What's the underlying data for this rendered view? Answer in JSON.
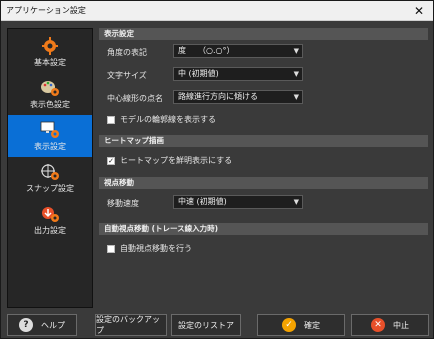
{
  "window": {
    "title": "アプリケーション設定",
    "close_glyph": "✕"
  },
  "sidebar": {
    "items": [
      {
        "label": "基本設定",
        "icon": "gear-icon",
        "active": false
      },
      {
        "label": "表示色設定",
        "icon": "palette-gear-icon",
        "active": false
      },
      {
        "label": "表示設定",
        "icon": "monitor-gear-icon",
        "active": true
      },
      {
        "label": "スナップ設定",
        "icon": "snap-gear-icon",
        "active": false
      },
      {
        "label": "出力設定",
        "icon": "output-gear-icon",
        "active": false
      }
    ]
  },
  "sections": {
    "display": {
      "header": "表示設定",
      "angle_label": "角度の表記",
      "angle_value": "度　　（○.○°）",
      "text_size_label": "文字サイズ",
      "text_size_value": "中 (初期値)",
      "center_label": "中心線形の点名",
      "center_value": "路線進行方向に傾ける",
      "model_outline_label": "モデルの輪郭線を表示する",
      "model_outline_checked": false
    },
    "heatmap": {
      "header": "ヒートマップ描画",
      "vivid_label": "ヒートマップを鮮明表示にする",
      "vivid_checked": true
    },
    "viewpoint": {
      "header": "視点移動",
      "speed_label": "移動速度",
      "speed_value": "中速 (初期値)"
    },
    "auto_viewpoint": {
      "header": "自動視点移動 (トレース線入力時)",
      "auto_label": "自動視点移動を行う",
      "auto_checked": false
    }
  },
  "footer": {
    "help": "ヘルプ",
    "backup": "設定のバックアップ",
    "restore": "設定のリストア",
    "ok": "確定",
    "cancel": "中止"
  },
  "colors": {
    "accent": "#0a6fd6",
    "ok_icon": "#f5a300",
    "cancel_icon": "#e8502a"
  }
}
